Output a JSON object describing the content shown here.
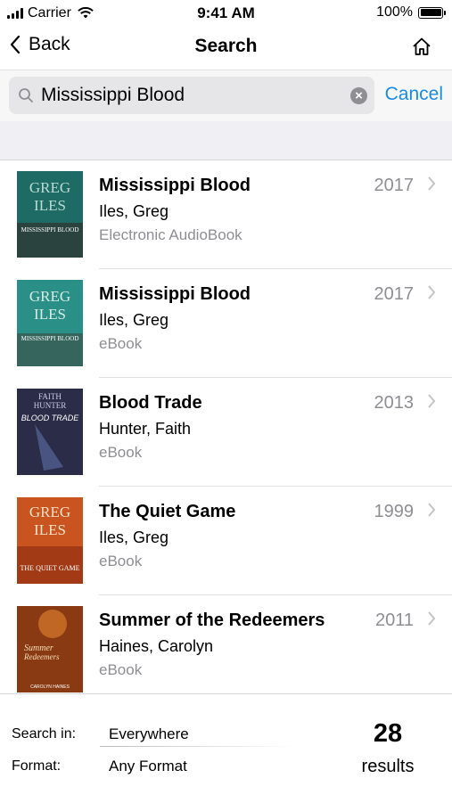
{
  "status_bar": {
    "carrier": "Carrier",
    "time": "9:41 AM",
    "battery": "100%"
  },
  "nav": {
    "back_label": "Back",
    "title": "Search"
  },
  "search": {
    "query": "Mississippi Blood",
    "cancel_label": "Cancel"
  },
  "results": [
    {
      "title": "Mississippi Blood",
      "author": "Iles, Greg",
      "format": "Electronic AudioBook",
      "year": "2017",
      "cover": {
        "top": "GREG",
        "mid": "ILES",
        "bottom": "MISSISSIPPI BLOOD",
        "bg": "#1d6b64",
        "fg": "#b9dbd4"
      }
    },
    {
      "title": "Mississippi Blood",
      "author": "Iles, Greg",
      "format": "eBook",
      "year": "2017",
      "cover": {
        "top": "GREG",
        "mid": "ILES",
        "bottom": "MISSISSIPPI BLOOD",
        "bg": "#2a8f86",
        "fg": "#d8ece7"
      }
    },
    {
      "title": "Blood Trade",
      "author": "Hunter, Faith",
      "format": "eBook",
      "year": "2013",
      "cover": {
        "top": "FAITH",
        "mid": "HUNTER",
        "bottom": "BLOOD TRADE",
        "bg": "#2b2c48",
        "fg": "#c8ccea"
      }
    },
    {
      "title": "The Quiet Game",
      "author": "Iles, Greg",
      "format": "eBook",
      "year": "1999",
      "cover": {
        "top": "GREG",
        "mid": "ILES",
        "bottom": "THE QUIET GAME",
        "bg": "#c9541f",
        "fg": "#ffe2c8"
      }
    },
    {
      "title": "Summer of the Redeemers",
      "author": "Haines, Carolyn",
      "format": "eBook",
      "year": "2011",
      "cover": {
        "top": "Summer",
        "mid": "Redeemers",
        "bottom": "CAROLYN HAINES",
        "bg": "#8a3a12",
        "fg": "#f6dfb8"
      }
    }
  ],
  "footer": {
    "search_in_label": "Search in:",
    "search_in_value": "Everywhere",
    "format_label": "Format:",
    "format_value": "Any Format",
    "count": "28",
    "results_label": "results"
  },
  "colors": {
    "accent": "#1a8ce0",
    "secondary_text": "#8e8e93"
  },
  "icons": [
    "signal-icon",
    "wifi-icon",
    "battery-icon",
    "back-chevron-icon",
    "home-icon",
    "search-icon",
    "clear-icon",
    "chevron-right-icon"
  ]
}
